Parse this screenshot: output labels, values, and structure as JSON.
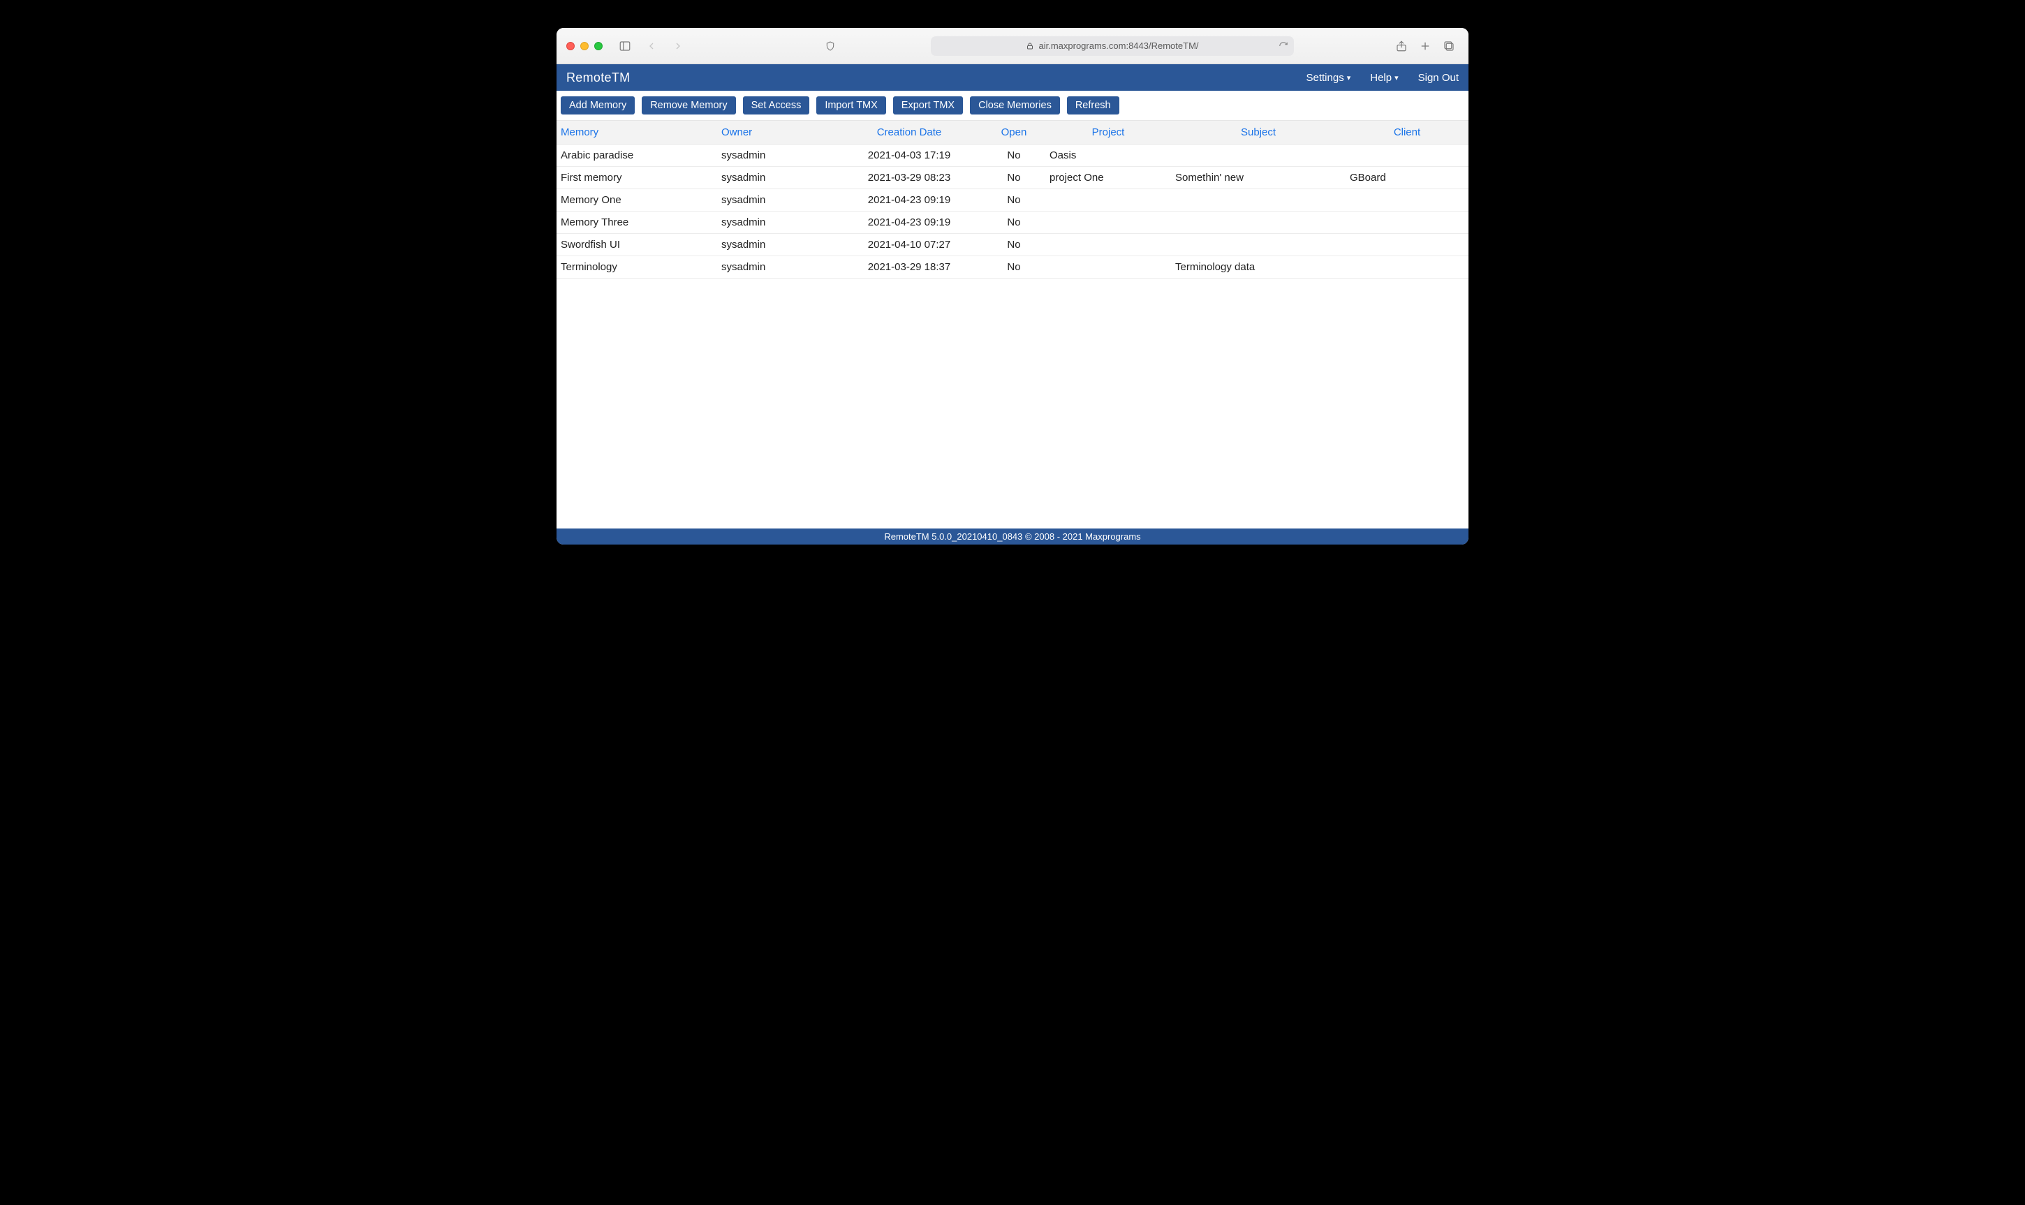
{
  "browser": {
    "url": "air.maxprograms.com:8443/RemoteTM/"
  },
  "app": {
    "title": "RemoteTM",
    "menus": {
      "settings": "Settings",
      "help": "Help",
      "signout": "Sign Out"
    }
  },
  "toolbar": {
    "add": "Add Memory",
    "remove": "Remove Memory",
    "access": "Set Access",
    "import": "Import TMX",
    "export": "Export TMX",
    "close": "Close Memories",
    "refresh": "Refresh"
  },
  "table": {
    "headers": {
      "memory": "Memory",
      "owner": "Owner",
      "date": "Creation Date",
      "open": "Open",
      "project": "Project",
      "subject": "Subject",
      "client": "Client"
    },
    "rows": [
      {
        "memory": "Arabic paradise",
        "owner": "sysadmin",
        "date": "2021-04-03 17:19",
        "open": "No",
        "project": "Oasis",
        "subject": "",
        "client": ""
      },
      {
        "memory": "First memory",
        "owner": "sysadmin",
        "date": "2021-03-29 08:23",
        "open": "No",
        "project": "project One",
        "subject": "Somethin' new",
        "client": "GBoard"
      },
      {
        "memory": "Memory One",
        "owner": "sysadmin",
        "date": "2021-04-23 09:19",
        "open": "No",
        "project": "",
        "subject": "",
        "client": ""
      },
      {
        "memory": "Memory Three",
        "owner": "sysadmin",
        "date": "2021-04-23 09:19",
        "open": "No",
        "project": "",
        "subject": "",
        "client": ""
      },
      {
        "memory": "Swordfish UI",
        "owner": "sysadmin",
        "date": "2021-04-10 07:27",
        "open": "No",
        "project": "",
        "subject": "",
        "client": ""
      },
      {
        "memory": "Terminology",
        "owner": "sysadmin",
        "date": "2021-03-29 18:37",
        "open": "No",
        "project": "",
        "subject": "Terminology data",
        "client": ""
      }
    ]
  },
  "footer": {
    "text": "RemoteTM 5.0.0_20210410_0843 © 2008 - 2021 Maxprograms"
  }
}
